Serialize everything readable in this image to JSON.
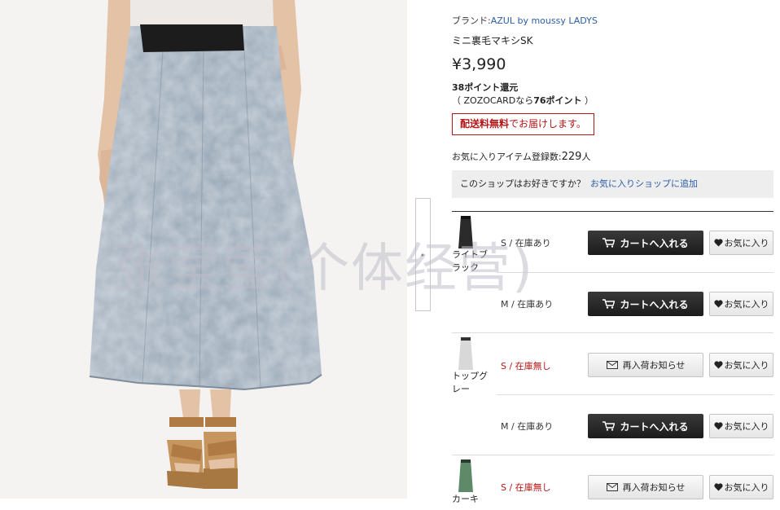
{
  "product": {
    "brand_label": "ブランド:",
    "brand_name": "AZUL by moussy LADYS",
    "name": "ミニ裏毛マキシSK",
    "price": "¥3,990",
    "points": "38ポイント還元",
    "zozo_prefix": "（ ZOZOCARDなら",
    "zozo_points": "76ポイント",
    "zozo_suffix": " ）",
    "shipping_bold": "配送料無料",
    "shipping_rest": "でお届けします。",
    "fav_label": "お気に入りアイテム登録数:",
    "fav_count": "229",
    "fav_unit": "人"
  },
  "shop_prompt": {
    "question": "このショップはお好きですか？",
    "link": "お気に入りショップに追加"
  },
  "watermark": "张莹莹(个体经营)",
  "panel_toggle": "▸",
  "colors": {
    "accent_red": "#b41515",
    "link_blue": "#2a5ca8",
    "skirt": "#9fadba",
    "waistband": "#1c1c1c"
  },
  "variants": [
    {
      "color": "ライトブラック",
      "thumb_color": "#2b2b2b",
      "sizes": [
        {
          "size_stock": "S / 在庫あり",
          "in_stock": true,
          "action": "カートへ入れる",
          "fav": "お気に入り"
        },
        {
          "size_stock": "M / 在庫あり",
          "in_stock": true,
          "action": "カートへ入れる",
          "fav": "お気に入り"
        }
      ]
    },
    {
      "color": "トップグレー",
      "thumb_color": "#d8d8d8",
      "sizes": [
        {
          "size_stock": "S / 在庫無し",
          "in_stock": false,
          "action": "再入荷お知らせ",
          "fav": "お気に入り"
        },
        {
          "size_stock": "M / 在庫あり",
          "in_stock": true,
          "action": "カートへ入れる",
          "fav": "お気に入り"
        }
      ]
    },
    {
      "color": "カーキ",
      "thumb_color": "#5f8a6a",
      "sizes": [
        {
          "size_stock": "S / 在庫無し",
          "in_stock": false,
          "action": "再入荷お知らせ",
          "fav": "お気に入り"
        }
      ]
    }
  ]
}
